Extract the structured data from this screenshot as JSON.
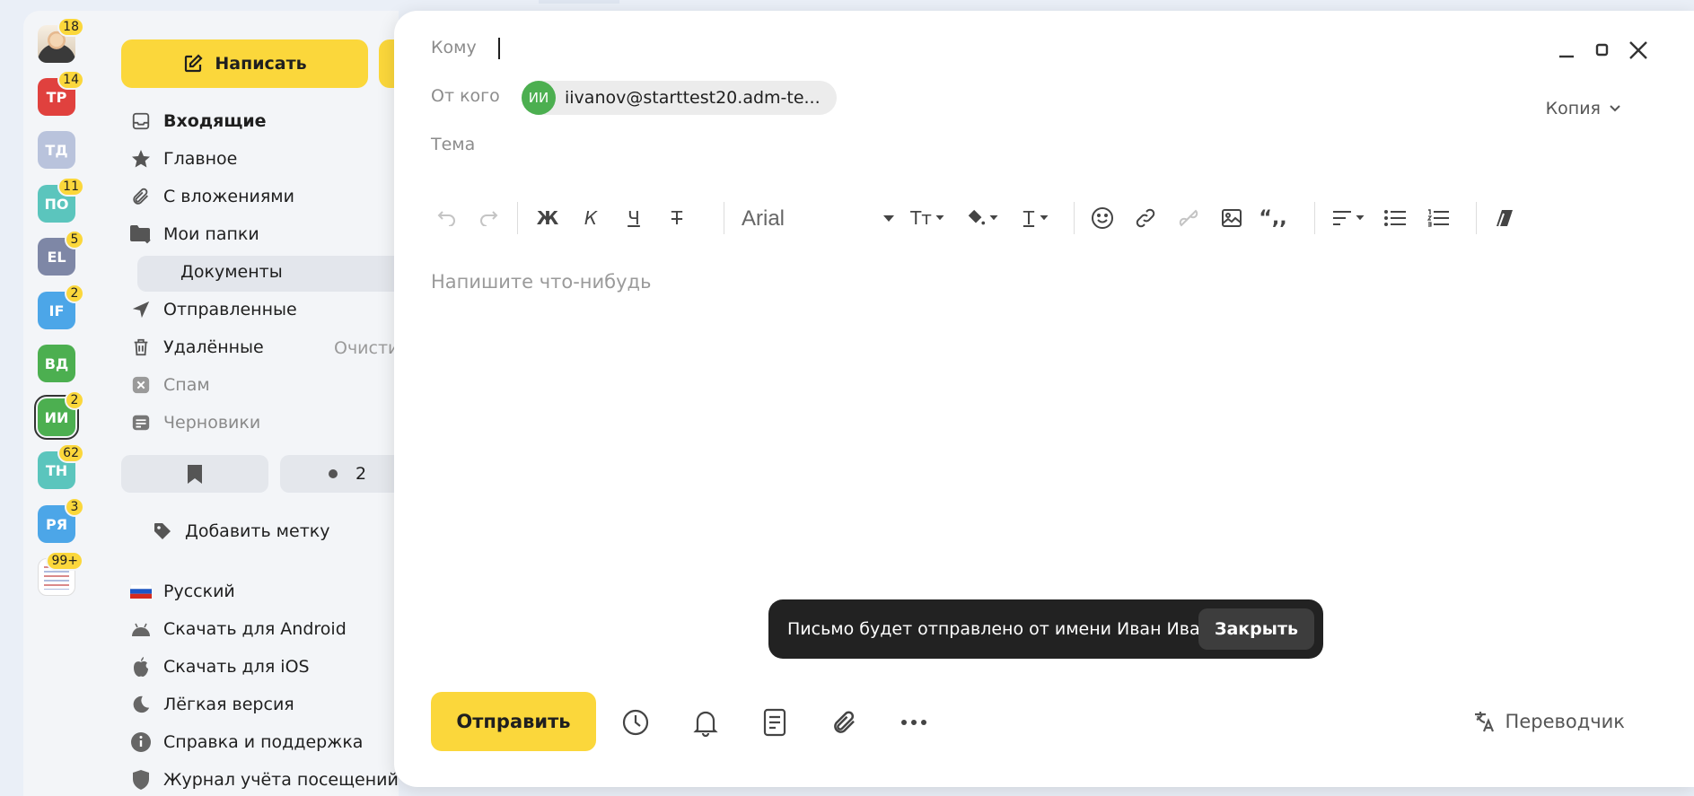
{
  "accounts": [
    {
      "initials": "",
      "badge": "18",
      "color": "#d9d0c3",
      "kind": "photo"
    },
    {
      "initials": "ТР",
      "badge": "14",
      "color": "#e0413e"
    },
    {
      "initials": "ТД",
      "badge": "",
      "color": "#b9c3dc"
    },
    {
      "initials": "ПО",
      "badge": "11",
      "color": "#5bc5bd"
    },
    {
      "initials": "EL",
      "badge": "5",
      "color": "#7e87a6"
    },
    {
      "initials": "IF",
      "badge": "2",
      "color": "#4ca6e8"
    },
    {
      "initials": "ВД",
      "badge": "",
      "color": "#4caf50"
    },
    {
      "initials": "ИИ",
      "badge": "2",
      "color": "#4caf50",
      "active": true
    },
    {
      "initials": "ТН",
      "badge": "62",
      "color": "#5bc5bd"
    },
    {
      "initials": "РЯ",
      "badge": "3",
      "color": "#4ca6e8"
    },
    {
      "initials": "",
      "badge": "99+",
      "color": "#ffffff",
      "kind": "doc"
    }
  ],
  "sidebar": {
    "compose_label": "Написать",
    "folders": {
      "inbox": "Входящие",
      "main": "Главное",
      "attachments": "С вложениями",
      "my_folders": "Мои папки",
      "documents": "Документы",
      "sent": "Отправленные",
      "deleted": "Удалённые",
      "clear": "Очисти",
      "spam": "Спам",
      "drafts": "Черновики"
    },
    "unread_count": "2",
    "add_label": "Добавить метку",
    "links": {
      "language": "Русский",
      "android": "Скачать для Android",
      "ios": "Скачать для iOS",
      "lite": "Лёгкая версия",
      "help": "Справка и поддержка",
      "journal": "Журнал учёта посещений"
    }
  },
  "compose": {
    "to_label": "Кому",
    "from_label": "От кого",
    "from_initials": "ИИ",
    "from_email": "iivanov@starttest20.adm-te...",
    "copy_label": "Копия",
    "subject_label": "Тема",
    "font_name": "Arial",
    "toolbar": {
      "bold": "Ж",
      "italic": "К",
      "underline": "Ч",
      "strike": "Т",
      "text_size": "Тт",
      "text_color": "Т",
      "quote": "“,,"
    },
    "body_placeholder": "Напишите что-нибудь",
    "send_label": "Отправить",
    "translator_label": "Переводчик"
  },
  "toast": {
    "message": "Письмо будет отправлено от имени Иван Иванов",
    "close_label": "Закрыть"
  }
}
